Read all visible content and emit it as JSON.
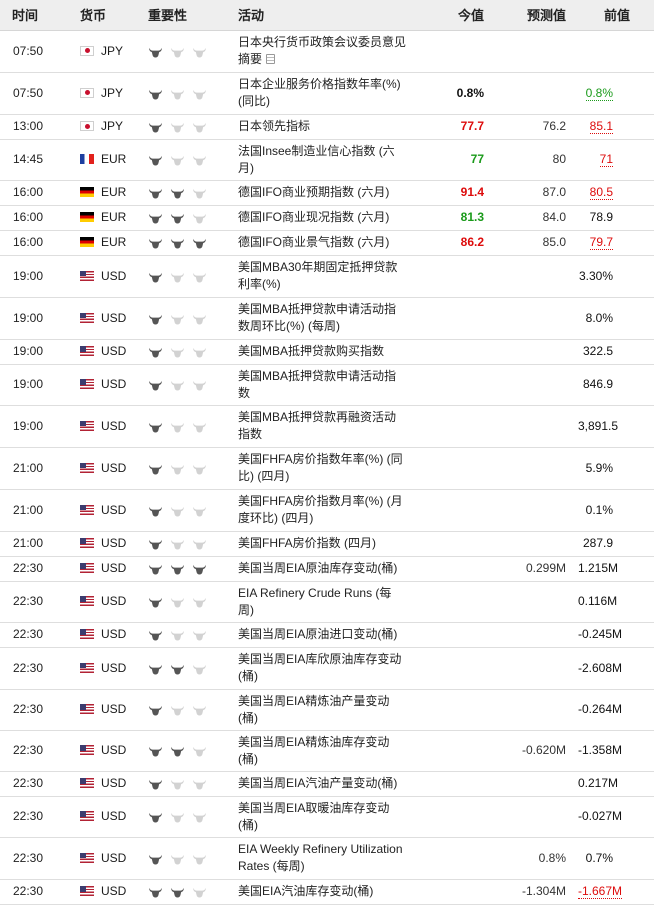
{
  "headers": {
    "time": "时间",
    "currency": "货币",
    "importance": "重要性",
    "event": "活动",
    "actual": "今值",
    "forecast": "预测值",
    "previous": "前值"
  },
  "colors": {
    "bull_active": "#555555",
    "bull_inactive": "#d2d2d2",
    "positive": "#1a9a1a",
    "negative": "#dd0b0b"
  },
  "rows": [
    {
      "time": "07:50",
      "flag": "jp",
      "currency": "JPY",
      "importance": 1,
      "event": "日本央行货币政策会议委员意见摘要",
      "doc_icon": true,
      "actual": "",
      "actual_color": "",
      "forecast": "",
      "previous": "",
      "previous_color": "",
      "tall": true
    },
    {
      "time": "07:50",
      "flag": "jp",
      "currency": "JPY",
      "importance": 1,
      "event": "日本企业服务价格指数年率(%) (同比)",
      "actual": "0.8%",
      "actual_color": "black",
      "forecast": "",
      "previous": "0.8%",
      "previous_color": "green",
      "tall": true
    },
    {
      "time": "13:00",
      "flag": "jp",
      "currency": "JPY",
      "importance": 1,
      "event": "日本领先指标",
      "actual": "77.7",
      "actual_color": "red",
      "forecast": "76.2",
      "previous": "85.1",
      "previous_color": "red",
      "tall": false
    },
    {
      "time": "14:45",
      "flag": "fr",
      "currency": "EUR",
      "importance": 1,
      "event": "法国Insee制造业信心指数 (六月)",
      "actual": "77",
      "actual_color": "green",
      "forecast": "80",
      "previous": "71",
      "previous_color": "red",
      "tall": false
    },
    {
      "time": "16:00",
      "flag": "de",
      "currency": "EUR",
      "importance": 2,
      "event": "德国IFO商业预期指数 (六月)",
      "actual": "91.4",
      "actual_color": "red",
      "forecast": "87.0",
      "previous": "80.5",
      "previous_color": "red",
      "tall": false
    },
    {
      "time": "16:00",
      "flag": "de",
      "currency": "EUR",
      "importance": 2,
      "event": "德国IFO商业现况指数 (六月)",
      "actual": "81.3",
      "actual_color": "green",
      "forecast": "84.0",
      "previous": "78.9",
      "previous_color": "black",
      "tall": false
    },
    {
      "time": "16:00",
      "flag": "de",
      "currency": "EUR",
      "importance": 3,
      "event": "德国IFO商业景气指数 (六月)",
      "actual": "86.2",
      "actual_color": "red",
      "forecast": "85.0",
      "previous": "79.7",
      "previous_color": "red",
      "tall": false
    },
    {
      "time": "19:00",
      "flag": "us",
      "currency": "USD",
      "importance": 1,
      "event": "美国MBA30年期固定抵押贷款利率(%)",
      "actual": "",
      "actual_color": "",
      "forecast": "",
      "previous": "3.30%",
      "previous_color": "black",
      "tall": true
    },
    {
      "time": "19:00",
      "flag": "us",
      "currency": "USD",
      "importance": 1,
      "event": "美国MBA抵押贷款申请活动指数周环比(%) (每周)",
      "actual": "",
      "actual_color": "",
      "forecast": "",
      "previous": "8.0%",
      "previous_color": "black",
      "tall": true
    },
    {
      "time": "19:00",
      "flag": "us",
      "currency": "USD",
      "importance": 1,
      "event": "美国MBA抵押贷款购买指数",
      "actual": "",
      "actual_color": "",
      "forecast": "",
      "previous": "322.5",
      "previous_color": "black",
      "tall": false
    },
    {
      "time": "19:00",
      "flag": "us",
      "currency": "USD",
      "importance": 1,
      "event": "美国MBA抵押贷款申请活动指数",
      "actual": "",
      "actual_color": "",
      "forecast": "",
      "previous": "846.9",
      "previous_color": "black",
      "tall": false
    },
    {
      "time": "19:00",
      "flag": "us",
      "currency": "USD",
      "importance": 1,
      "event": "美国MBA抵押贷款再融资活动指数",
      "actual": "",
      "actual_color": "",
      "forecast": "",
      "previous": "3,891.5",
      "previous_color": "black",
      "tall": true
    },
    {
      "time": "21:00",
      "flag": "us",
      "currency": "USD",
      "importance": 1,
      "event": "美国FHFA房价指数年率(%) (同比) (四月)",
      "actual": "",
      "actual_color": "",
      "forecast": "",
      "previous": "5.9%",
      "previous_color": "black",
      "tall": true
    },
    {
      "time": "21:00",
      "flag": "us",
      "currency": "USD",
      "importance": 1,
      "event": "美国FHFA房价指数月率(%) (月度环比) (四月)",
      "actual": "",
      "actual_color": "",
      "forecast": "",
      "previous": "0.1%",
      "previous_color": "black",
      "tall": true
    },
    {
      "time": "21:00",
      "flag": "us",
      "currency": "USD",
      "importance": 1,
      "event": "美国FHFA房价指数 (四月)",
      "actual": "",
      "actual_color": "",
      "forecast": "",
      "previous": "287.9",
      "previous_color": "black",
      "tall": false
    },
    {
      "time": "22:30",
      "flag": "us",
      "currency": "USD",
      "importance": 3,
      "event": "美国当周EIA原油库存变动(桶)",
      "actual": "",
      "actual_color": "",
      "forecast": "0.299M",
      "previous": "1.215M",
      "previous_color": "black",
      "tall": false
    },
    {
      "time": "22:30",
      "flag": "us",
      "currency": "USD",
      "importance": 1,
      "event": "EIA Refinery Crude Runs (每周)",
      "actual": "",
      "actual_color": "",
      "forecast": "",
      "previous": "0.116M",
      "previous_color": "black",
      "tall": false
    },
    {
      "time": "22:30",
      "flag": "us",
      "currency": "USD",
      "importance": 1,
      "event": "美国当周EIA原油进口变动(桶)",
      "actual": "",
      "actual_color": "",
      "forecast": "",
      "previous": "-0.245M",
      "previous_color": "black",
      "tall": false
    },
    {
      "time": "22:30",
      "flag": "us",
      "currency": "USD",
      "importance": 2,
      "event": "美国当周EIA库欣原油库存变动(桶)",
      "actual": "",
      "actual_color": "",
      "forecast": "",
      "previous": "-2.608M",
      "previous_color": "black",
      "tall": true
    },
    {
      "time": "22:30",
      "flag": "us",
      "currency": "USD",
      "importance": 1,
      "event": "美国当周EIA精炼油产量变动(桶)",
      "actual": "",
      "actual_color": "",
      "forecast": "",
      "previous": "-0.264M",
      "previous_color": "black",
      "tall": false
    },
    {
      "time": "22:30",
      "flag": "us",
      "currency": "USD",
      "importance": 2,
      "event": "美国当周EIA精炼油库存变动(桶)",
      "actual": "",
      "actual_color": "",
      "forecast": "-0.620M",
      "previous": "-1.358M",
      "previous_color": "black",
      "tall": false
    },
    {
      "time": "22:30",
      "flag": "us",
      "currency": "USD",
      "importance": 1,
      "event": "美国当周EIA汽油产量变动(桶)",
      "actual": "",
      "actual_color": "",
      "forecast": "",
      "previous": "0.217M",
      "previous_color": "black",
      "tall": false
    },
    {
      "time": "22:30",
      "flag": "us",
      "currency": "USD",
      "importance": 1,
      "event": "美国当周EIA取暖油库存变动(桶)",
      "actual": "",
      "actual_color": "",
      "forecast": "",
      "previous": "-0.027M",
      "previous_color": "black",
      "tall": false
    },
    {
      "time": "22:30",
      "flag": "us",
      "currency": "USD",
      "importance": 1,
      "event": "EIA Weekly Refinery Utilization Rates (每周)",
      "actual": "",
      "actual_color": "",
      "forecast": "0.8%",
      "previous": "0.7%",
      "previous_color": "black",
      "tall": true
    },
    {
      "time": "22:30",
      "flag": "us",
      "currency": "USD",
      "importance": 2,
      "event": "美国EIA汽油库存变动(桶)",
      "actual": "",
      "actual_color": "",
      "forecast": "-1.304M",
      "previous": "-1.667M",
      "previous_color": "red",
      "tall": false
    }
  ]
}
